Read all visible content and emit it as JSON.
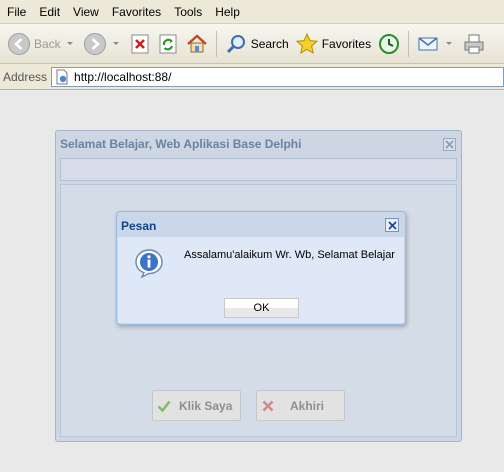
{
  "menu": [
    "File",
    "Edit",
    "View",
    "Favorites",
    "Tools",
    "Help"
  ],
  "toolbar": {
    "back_label": "Back",
    "search_label": "Search",
    "favorites_label": "Favorites"
  },
  "address": {
    "label": "Address",
    "url": "http://localhost:88/"
  },
  "main_window": {
    "title": "Selamat Belajar, Web Aplikasi Base Delphi",
    "klik_label": "Klik Saya",
    "akhiri_label": "Akhiri"
  },
  "dialog": {
    "title": "Pesan",
    "message": "Assalamu'alaikum Wr. Wb, Selamat Belajar",
    "ok_label": "OK"
  },
  "colors": {
    "dialog_title": "#15428b",
    "window_title": "#6a82a3",
    "check_green": "#4caf50",
    "cross_red": "#c0392b"
  }
}
